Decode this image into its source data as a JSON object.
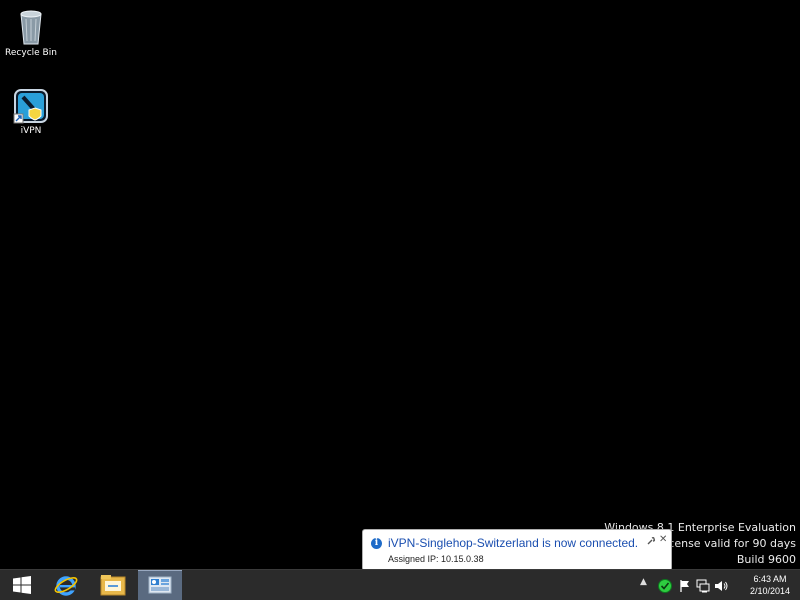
{
  "desktop": {
    "icons": [
      {
        "label": "Recycle Bin"
      },
      {
        "label": "iVPN"
      }
    ]
  },
  "watermark": {
    "line1": "Windows 8.1 Enterprise Evaluation",
    "line2": "Windows License valid for 90 days",
    "line3": "Build 9600"
  },
  "notification": {
    "title": "iVPN-Singlehop-Switzerland is now connected.",
    "body": "Assigned IP: 10.15.0.38",
    "icon": "info-icon"
  },
  "taskbar": {
    "buttons": [
      "start-icon",
      "internet-explorer-icon",
      "file-explorer-icon",
      "server-manager-icon"
    ],
    "tray_icons": [
      "show-hidden-icons-chevron",
      "ivpn-tray-icon",
      "action-center-flag-icon",
      "network-icon",
      "volume-icon"
    ],
    "clock": {
      "time": "6:43 AM",
      "date": "2/10/2014"
    }
  },
  "colors": {
    "desktop": "#000000",
    "taskbar": "#2b2b2b",
    "notification_title": "#1b4fb0",
    "vpn_connected": "#2ecc40"
  }
}
